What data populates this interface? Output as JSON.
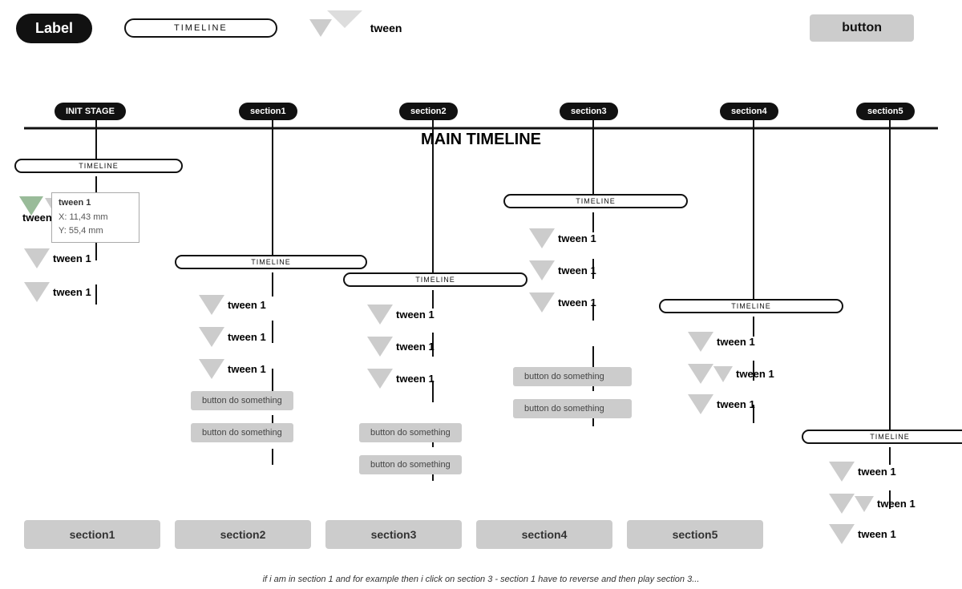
{
  "legend": {
    "label": "Label",
    "timeline": "TIMELINE",
    "tween": "tween",
    "button": "button"
  },
  "mainTimeline": "MAIN TIMELINE",
  "stages": {
    "init": "INIT STAGE",
    "s1": "section1",
    "s2": "section2",
    "s3": "section3",
    "s4": "section4",
    "s5": "section5"
  },
  "tweenLabel": "tween 1",
  "buttonLabel": "button do something",
  "bottomSections": [
    "section1",
    "section2",
    "section3",
    "section4",
    "section5"
  ],
  "bottomNote": "if i am in section 1 and for example then i click on section 3 - section 1 have to reverse and then play section 3...",
  "tooltip": {
    "x": "X: 11,43 mm",
    "y": "Y: 55,4 mm"
  }
}
